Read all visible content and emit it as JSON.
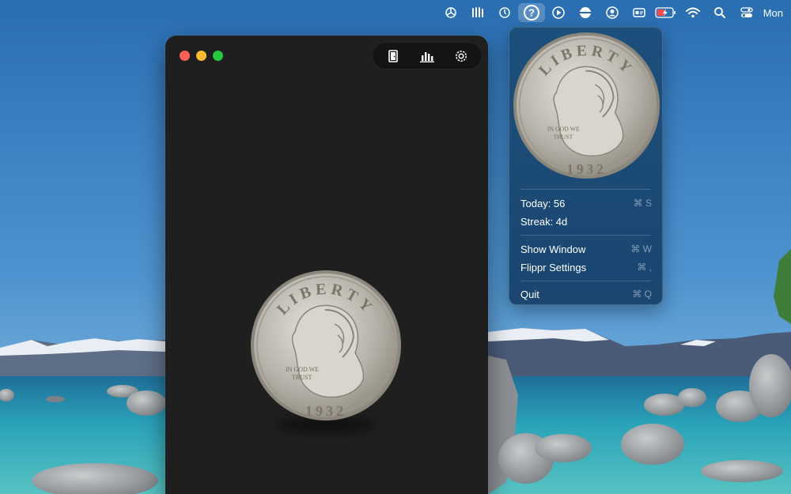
{
  "menubar": {
    "icons": [
      {
        "name": "openai-icon"
      },
      {
        "name": "hands-icon"
      },
      {
        "name": "history-icon"
      },
      {
        "name": "help-icon",
        "active": true
      },
      {
        "name": "play-icon"
      },
      {
        "name": "coin-flip-icon"
      },
      {
        "name": "user-icon"
      },
      {
        "name": "id-card-icon"
      },
      {
        "name": "battery-charging-icon"
      },
      {
        "name": "wifi-icon"
      },
      {
        "name": "search-icon"
      },
      {
        "name": "control-center-icon"
      }
    ],
    "clock": "Mon"
  },
  "window": {
    "toolbar": [
      {
        "name": "door-icon"
      },
      {
        "name": "stats-icon"
      },
      {
        "name": "settings-icon"
      }
    ],
    "coin": {
      "legend": "LIBERTY",
      "motto_line1": "IN GOD WE",
      "motto_line2": "TRUST",
      "year": "1932"
    }
  },
  "menu": {
    "coin": {
      "legend": "LIBERTY",
      "motto_line1": "IN GOD WE",
      "motto_line2": "TRUST",
      "year": "1932"
    },
    "stats": [
      {
        "label": "Today: 56",
        "shortcut": "⌘ S"
      },
      {
        "label": "Streak: 4d",
        "shortcut": ""
      }
    ],
    "actions": [
      {
        "label": "Show Window",
        "shortcut": "⌘ W"
      },
      {
        "label": "Flippr Settings",
        "shortcut": "⌘ ,"
      }
    ],
    "quit": {
      "label": "Quit",
      "shortcut": "⌘ Q"
    }
  },
  "colors": {
    "window_bg": "#1f1f1f",
    "menu_bg": "#1d4f7c",
    "close": "#ff5f57",
    "minimize": "#febc2e",
    "zoom": "#28c840"
  }
}
